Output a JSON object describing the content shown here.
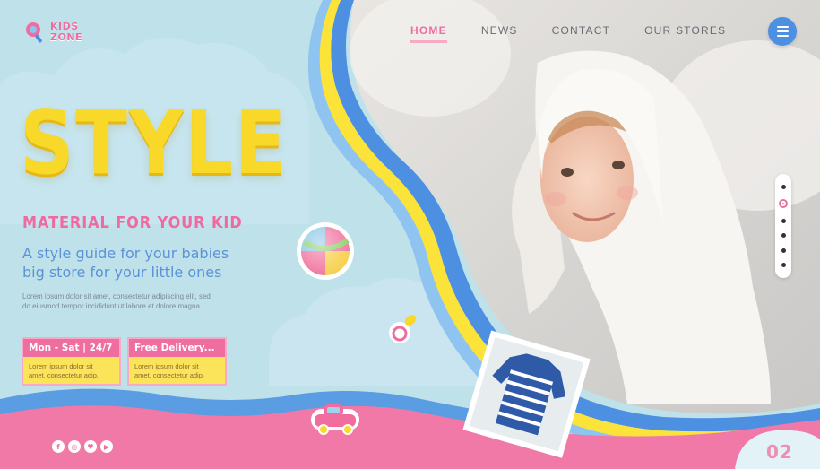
{
  "logo": {
    "line1": "KIDS",
    "line2": "ZONE"
  },
  "nav": {
    "items": [
      {
        "label": "HOME",
        "active": true
      },
      {
        "label": "NEWS",
        "active": false
      },
      {
        "label": "CONTACT",
        "active": false
      },
      {
        "label": "OUR STORES",
        "active": false
      }
    ],
    "menu_icon": "hamburger-icon"
  },
  "hero": {
    "title": "STYLE",
    "subtitle": "MATERIAL FOR YOUR KID",
    "tagline_line1": "A style guide for your babies",
    "tagline_line2": "big store for your little ones",
    "body_line1": "Lorem ipsum dolor sit amet, consectetur adipiscing elit, sed",
    "body_line2": "do eiusmod tempor incididunt ut labore et dolore magna."
  },
  "info_boxes": [
    {
      "heading": "Mon - Sat | 24/7",
      "text_line1": "Lorem ipsum dolor sit",
      "text_line2": "amet, consectetur adip."
    },
    {
      "heading": "Free Delivery...",
      "text_line1": "Lorem ipsum dolor sit",
      "text_line2": "amet, consectetur adip."
    }
  ],
  "social": [
    {
      "name": "facebook-icon",
      "glyph": "f"
    },
    {
      "name": "instagram-icon",
      "glyph": "◎"
    },
    {
      "name": "twitter-icon",
      "glyph": "♥"
    },
    {
      "name": "youtube-icon",
      "glyph": "▶"
    }
  ],
  "slider": {
    "count": 6,
    "active_index": 1
  },
  "page_number": "02",
  "colors": {
    "pink": "#ef6ea0",
    "yellow": "#f8d92a",
    "blue": "#4d8fe0",
    "sky": "#bfe1ea"
  }
}
